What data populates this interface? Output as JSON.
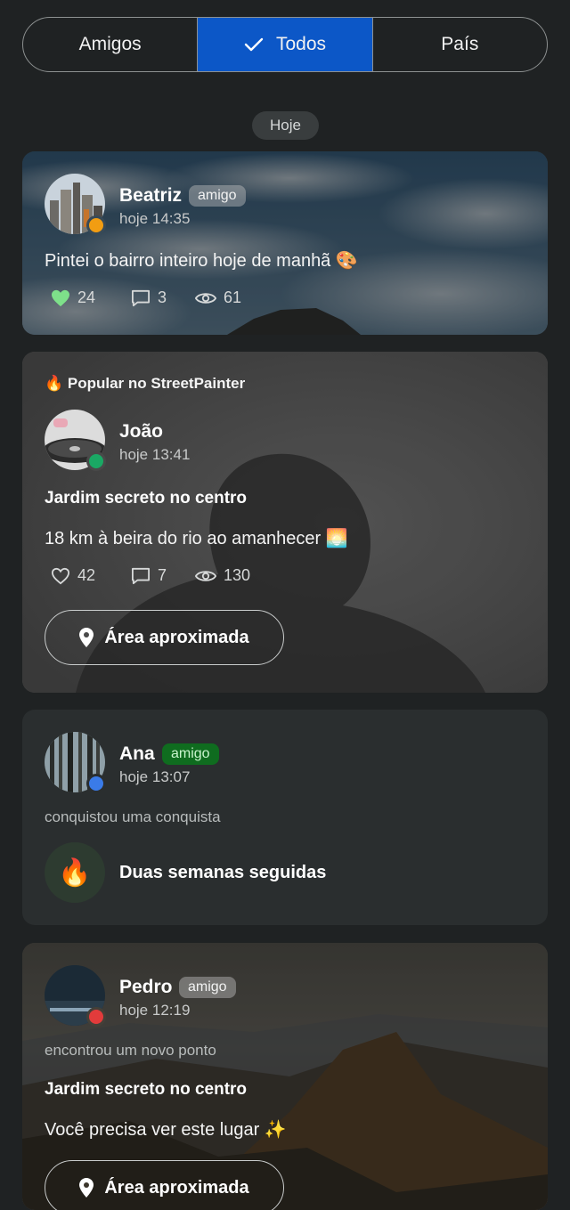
{
  "tabs": [
    {
      "label": "Amigos",
      "active": false
    },
    {
      "label": "Todos",
      "active": true
    },
    {
      "label": "País",
      "active": false
    }
  ],
  "date_chip": "Hoje",
  "colors": {
    "accent": "#0c57c7",
    "like_active": "#7ee08a",
    "status_orange": "#f29d12",
    "status_green": "#1aa864",
    "status_blue": "#3a7be8",
    "status_red": "#e23b3b"
  },
  "posts": [
    {
      "name": "Beatriz",
      "badge": "amigo",
      "time": "hoje 14:35",
      "text": "Pintei o bairro inteiro hoje de manhã 🎨",
      "likes": "24",
      "comments": "3",
      "views": "61",
      "liked": true,
      "icons": [
        "heart-icon",
        "comment-icon",
        "eye-icon"
      ]
    },
    {
      "popular_label": "🔥 Popular no StreetPainter",
      "name": "João",
      "time": "hoje 13:41",
      "title": "Jardim secreto no centro",
      "text": "18 km à beira do rio ao amanhecer 🌅",
      "likes": "42",
      "comments": "7",
      "views": "130",
      "button": "Área aproximada"
    },
    {
      "name": "Ana",
      "badge": "amigo",
      "time": "hoje 13:07",
      "activity": "conquistou uma conquista",
      "achievement_icon": "🔥",
      "achievement": "Duas semanas seguidas"
    },
    {
      "name": "Pedro",
      "badge": "amigo",
      "time": "hoje 12:19",
      "activity": "encontrou um novo ponto",
      "title": "Jardim secreto no centro",
      "text": "Você precisa ver este lugar ✨",
      "button": "Área aproximada"
    }
  ]
}
